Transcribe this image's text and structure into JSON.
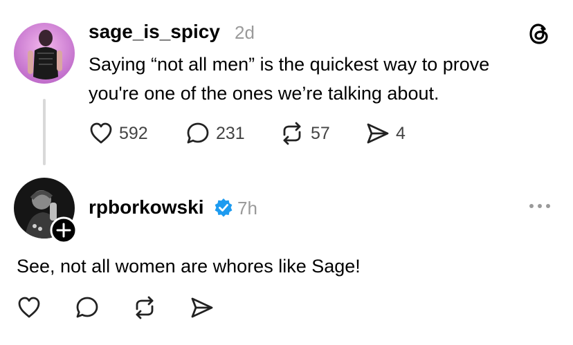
{
  "post1": {
    "username": "sage_is_spicy",
    "time": "2d",
    "text_line1": "Saying “not all men” is the quickest way to prove",
    "text_line2": "you're one of the ones we’re talking about.",
    "likes": "592",
    "replies": "231",
    "reposts": "57",
    "shares": "4"
  },
  "post2": {
    "username": "rpborkowski",
    "time": "7h",
    "text": "See, not all women are whores like Sage!"
  },
  "colors": {
    "verified": "#1d9bf0",
    "muted": "#9a9a9a",
    "thread_line": "#d9d9d9"
  },
  "icons": [
    "threads-logo-icon",
    "heart-icon",
    "comment-icon",
    "repost-icon",
    "share-icon",
    "verified-badge-icon",
    "follow-plus-icon",
    "more-options-icon"
  ]
}
